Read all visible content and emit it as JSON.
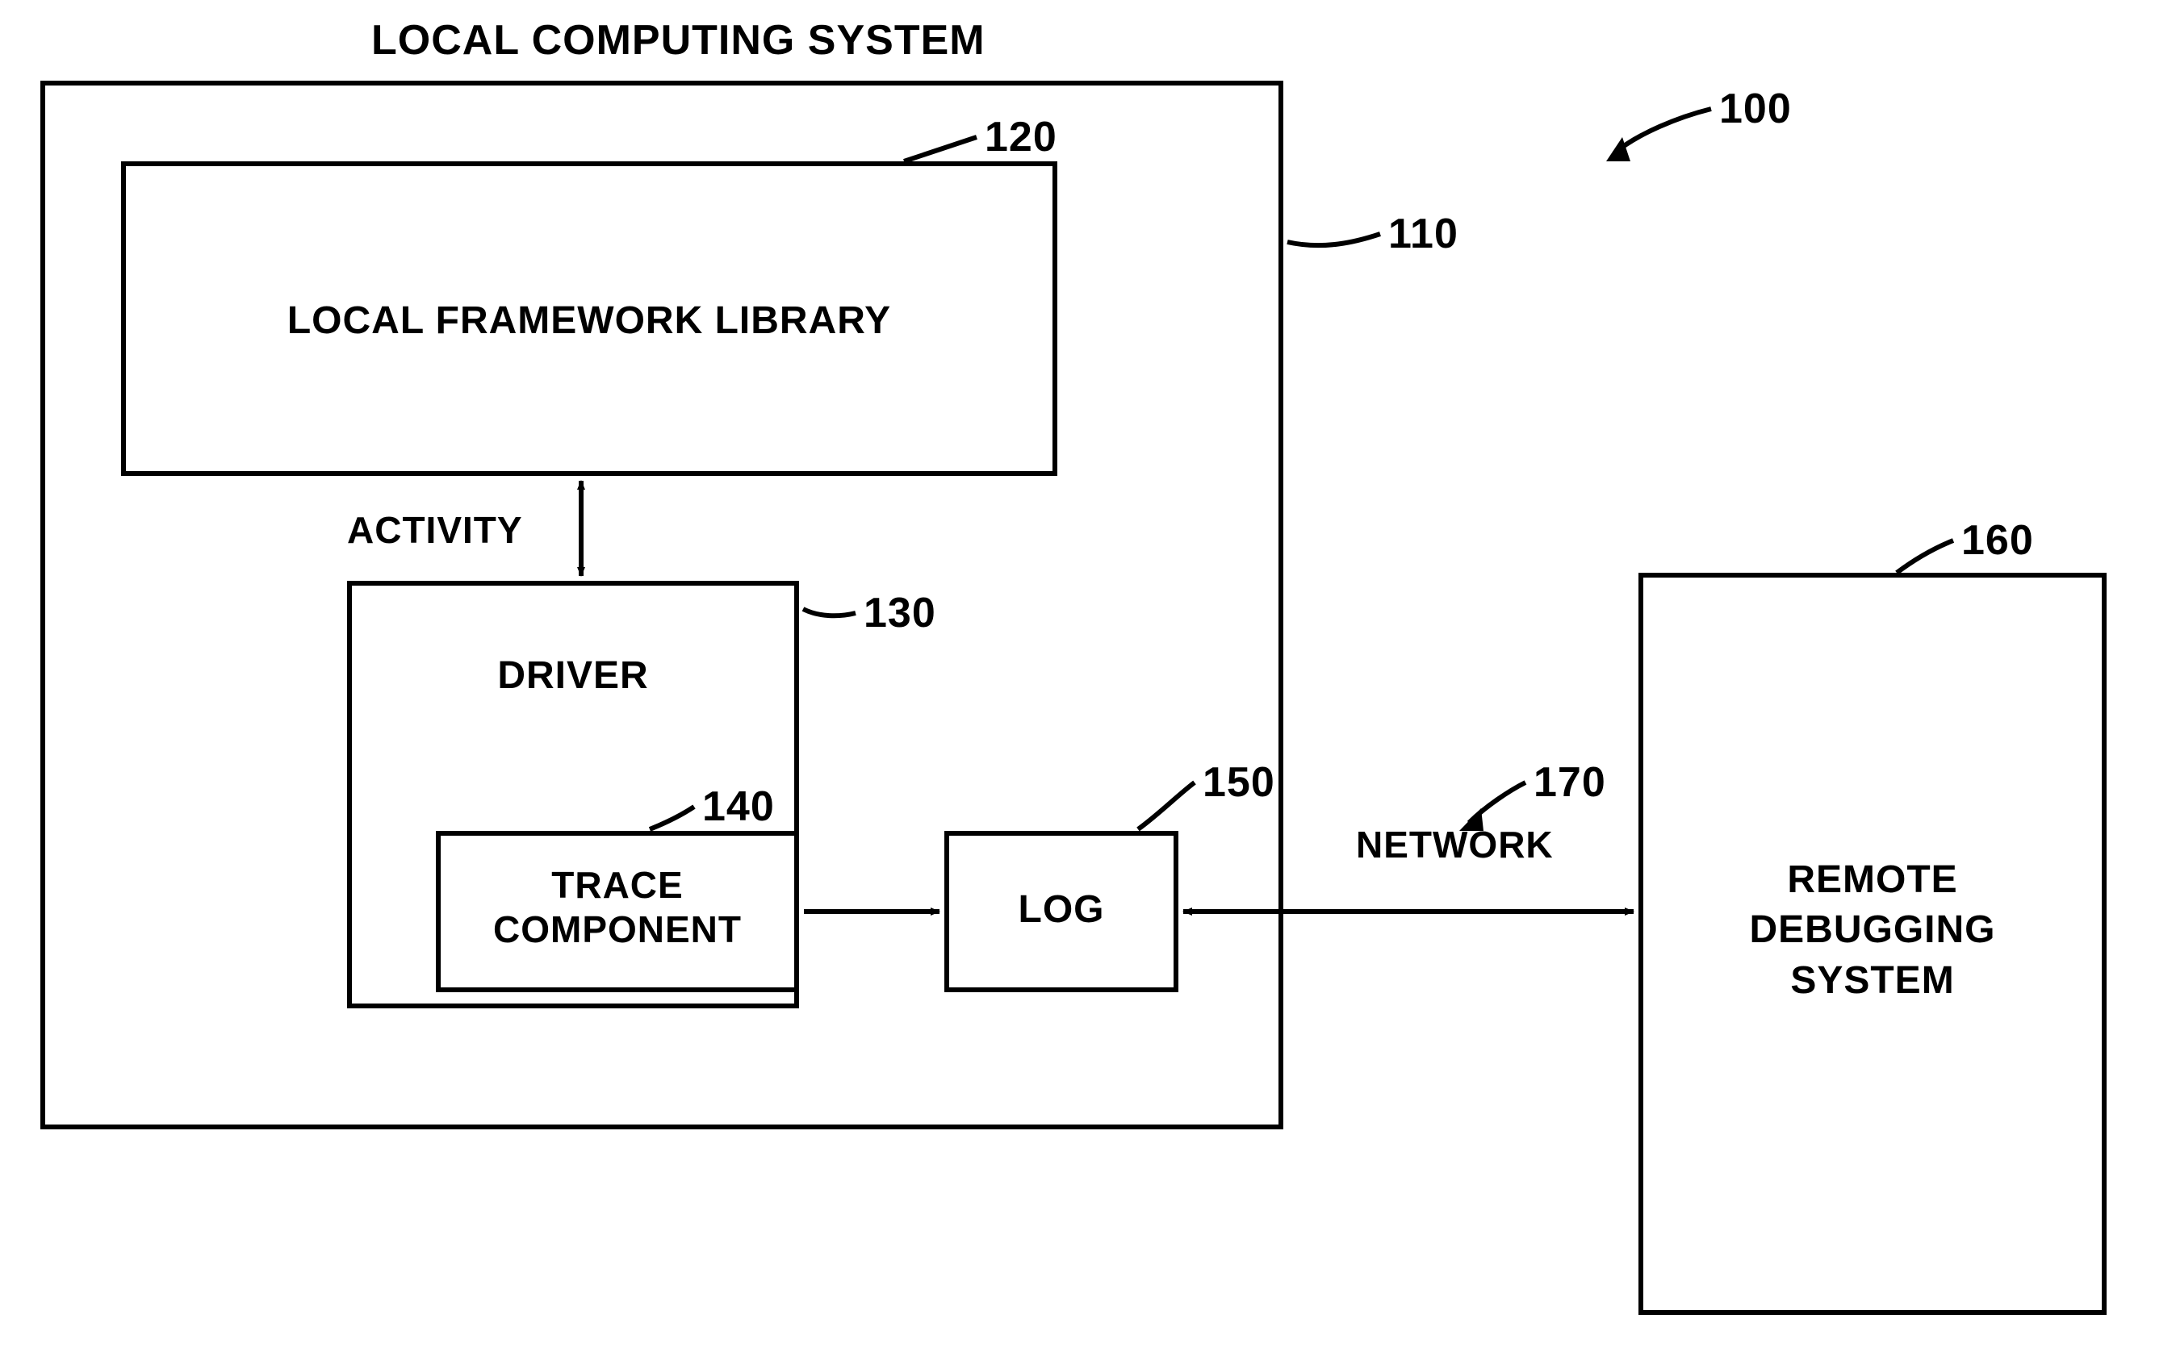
{
  "title": "LOCAL COMPUTING SYSTEM",
  "refs": {
    "system": "100",
    "local_computing_system": "110",
    "local_framework_library": "120",
    "driver": "130",
    "trace_component": "140",
    "log": "150",
    "remote_debugging_system": "160",
    "network": "170"
  },
  "boxes": {
    "local_framework_library": "LOCAL FRAMEWORK LIBRARY",
    "driver": "DRIVER",
    "trace_component": "TRACE\nCOMPONENT",
    "log": "LOG",
    "remote_debugging_system": "REMOTE\nDEBUGGING\nSYSTEM"
  },
  "labels": {
    "activity": "ACTIVITY",
    "network": "NETWORK"
  }
}
